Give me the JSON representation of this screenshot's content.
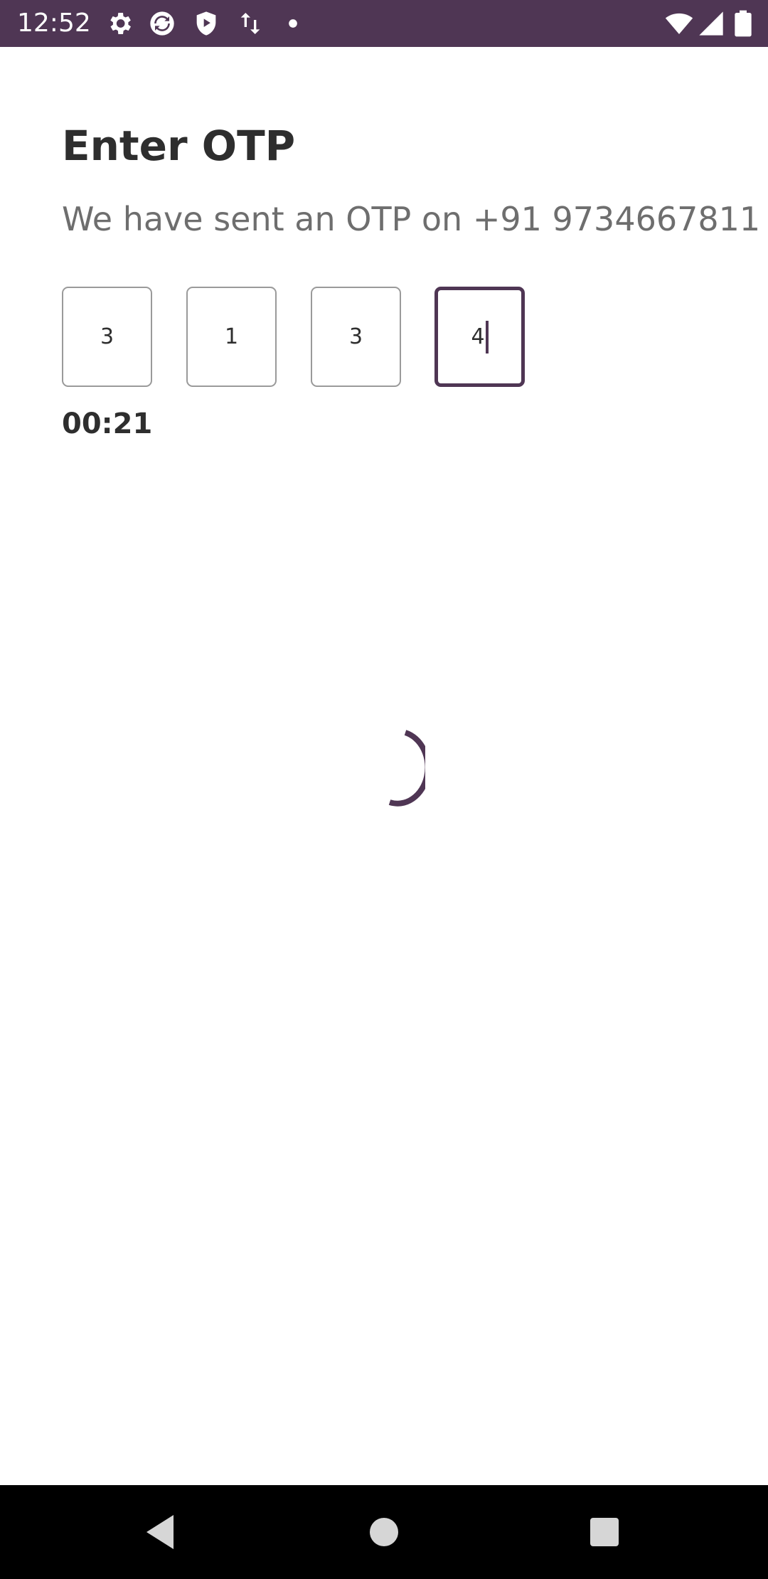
{
  "status_bar": {
    "time": "12:52",
    "left_icons": [
      "settings-icon",
      "sync-icon",
      "shield-play-icon",
      "data-transfer-icon",
      "dot-icon"
    ],
    "right_icons": [
      "wifi-icon",
      "cellular-signal-icon",
      "battery-icon"
    ],
    "background_color": "#4f3654"
  },
  "screen": {
    "title": "Enter OTP",
    "subtitle": "We have sent an OTP on +91 9734667811",
    "otp_digits": [
      "3",
      "1",
      "3",
      "4"
    ],
    "active_digit_index": 3,
    "timer": "00:21",
    "accent_color": "#4f3654",
    "loading": true
  },
  "nav_bar": {
    "buttons": [
      "back-icon",
      "home-icon",
      "recents-icon"
    ]
  }
}
